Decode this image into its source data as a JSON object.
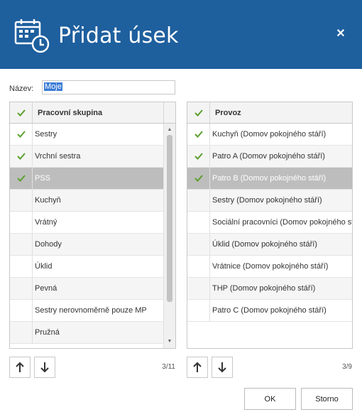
{
  "dialog": {
    "title": "Přidat úsek",
    "close_glyph": "✕",
    "header_color": "#1e5f9e",
    "icons": {
      "title_icon": "calendar-clock-icon",
      "close_icon": "close-icon"
    }
  },
  "name_field": {
    "label": "Název:",
    "value": "Moje"
  },
  "left_panel": {
    "header": "Pracovní skupina",
    "counter": "3/11",
    "rows": [
      {
        "label": "Sestry",
        "checked": true,
        "selected": false
      },
      {
        "label": "Vrchní sestra",
        "checked": true,
        "selected": false
      },
      {
        "label": "PSS",
        "checked": true,
        "selected": true
      },
      {
        "label": "Kuchyň",
        "checked": false,
        "selected": false
      },
      {
        "label": "Vrátný",
        "checked": false,
        "selected": false
      },
      {
        "label": "Dohody",
        "checked": false,
        "selected": false
      },
      {
        "label": "Úklid",
        "checked": false,
        "selected": false
      },
      {
        "label": "Pevná",
        "checked": false,
        "selected": false
      },
      {
        "label": "Sestry nerovnoměrně pouze MP",
        "checked": false,
        "selected": false
      },
      {
        "label": "Pružná",
        "checked": false,
        "selected": false
      }
    ]
  },
  "right_panel": {
    "header": "Provoz",
    "counter": "3/9",
    "rows": [
      {
        "label": "Kuchyň (Domov pokojného stáří)",
        "checked": true,
        "selected": false
      },
      {
        "label": "Patro A (Domov pokojného stáří)",
        "checked": true,
        "selected": false
      },
      {
        "label": "Patro B (Domov pokojného stáří)",
        "checked": true,
        "selected": true
      },
      {
        "label": "Sestry (Domov pokojného stáří)",
        "checked": false,
        "selected": false
      },
      {
        "label": "Sociální pracovníci (Domov pokojného stáří)",
        "checked": false,
        "selected": false
      },
      {
        "label": "Úklid (Domov pokojného stáří)",
        "checked": false,
        "selected": false
      },
      {
        "label": "Vrátnice (Domov pokojného stáří)",
        "checked": false,
        "selected": false
      },
      {
        "label": "THP (Domov pokojného stáří)",
        "checked": false,
        "selected": false
      },
      {
        "label": "Patro C (Domov pokojného stáří)",
        "checked": false,
        "selected": false
      }
    ]
  },
  "buttons": {
    "ok": "OK",
    "cancel": "Storno",
    "move_up_icon": "arrow-up-icon",
    "move_down_icon": "arrow-down-icon"
  },
  "colors": {
    "check": "#5aa02c",
    "selected_row": "#bdbdbd"
  }
}
